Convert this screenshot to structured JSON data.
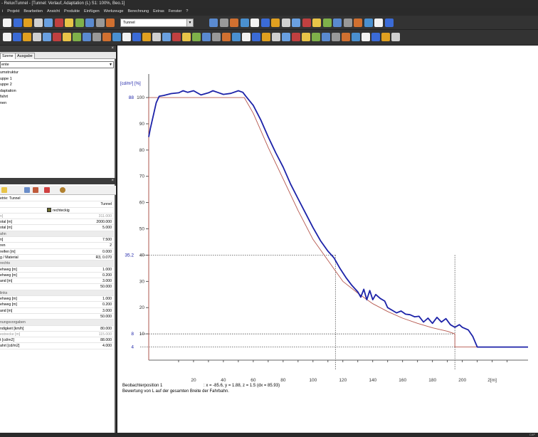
{
  "window": {
    "title": "- ReluxTunnel - [Tunnel: Verlauf, Adaptation (L) S1: 100%, Beo.1]"
  },
  "menu": {
    "items": [
      "i",
      "Projekt",
      "Bearbeiten",
      "Ansicht",
      "Produkte",
      "Einfügen",
      "Werkzeuge",
      "Berechnung",
      "Extras",
      "Fenster",
      "?"
    ]
  },
  "toolbar": {
    "tunnel_select": "Tunnel"
  },
  "left_panel": {
    "tabs": [
      "Szene",
      "Ausgabe"
    ],
    "tree_select": "ente",
    "tree_items": [
      "umstruktur",
      "uppe 1",
      "uppe 2",
      "daptation",
      "fahrt",
      "nen"
    ]
  },
  "properties": {
    "rows": [
      {
        "k": "etrie: Tunnel",
        "v": "",
        "type": "plain"
      },
      {
        "k": "",
        "v": "Tunnel",
        "type": "plain"
      },
      {
        "k": "",
        "v": "",
        "badge": "rechteckig",
        "type": "badge"
      },
      {
        "k": "n]",
        "v": "311.000",
        "type": "dim"
      },
      {
        "k": "otal [m]",
        "v": "2000.000",
        "type": "plain"
      },
      {
        "k": "otal [m]",
        "v": "5.000",
        "type": "plain"
      },
      {
        "k": "ahn",
        "v": "",
        "type": "section"
      },
      {
        "k": "n]",
        "v": "7.500",
        "type": "plain"
      },
      {
        "k": "ren",
        "v": "2",
        "type": "plain"
      },
      {
        "k": "reifen [m]",
        "v": "0.000",
        "type": "plain"
      },
      {
        "k": "g / Material",
        "v": "R3, 0.070",
        "type": "plain"
      },
      {
        "k": "rechts",
        "v": "",
        "type": "section"
      },
      {
        "k": "ehweg [m]",
        "v": "1.000",
        "type": "plain"
      },
      {
        "k": "ehweg [m]",
        "v": "0.200",
        "type": "plain"
      },
      {
        "k": "and [m]",
        "v": "3.000",
        "type": "plain"
      },
      {
        "k": "",
        "v": "50.000",
        "type": "plain"
      },
      {
        "k": "links",
        "v": "",
        "type": "section"
      },
      {
        "k": "ehweg [m]",
        "v": "1.000",
        "type": "plain"
      },
      {
        "k": "ehweg [m]",
        "v": "0.200",
        "type": "plain"
      },
      {
        "k": "and [m]",
        "v": "3.000",
        "type": "plain"
      },
      {
        "k": "",
        "v": "50.000",
        "type": "plain"
      },
      {
        "k": "nungsvorgaben",
        "v": "",
        "type": "section"
      },
      {
        "k": "ndigkeit [km/h]",
        "v": "80.000",
        "type": "plain"
      },
      {
        "k": "estrecke [m]",
        "v": "115.000",
        "type": "dim"
      },
      {
        "k": "t [cd/m2]",
        "v": "88.000",
        "type": "plain"
      },
      {
        "k": "ahrt [cd/m2]",
        "v": "4.000",
        "type": "plain"
      }
    ]
  },
  "chart_data": {
    "type": "line",
    "title": "",
    "ylabel": "[cd/m²] [%]",
    "xlabel": "[m]",
    "xlim": [
      -10,
      244
    ],
    "ylim": [
      0,
      103
    ],
    "x_ticks": [
      20,
      40,
      60,
      80,
      100,
      120,
      140,
      160,
      180,
      200,
      220
    ],
    "x_tick_labels": [
      "20",
      "40",
      "60",
      "80",
      "100",
      "120",
      "140",
      "160",
      "180",
      "200",
      "2[m]"
    ],
    "y_ticks": [
      10,
      20,
      30,
      40,
      50,
      60,
      70,
      80,
      90,
      100
    ],
    "y_tick_labels": [
      "10",
      "20",
      "30",
      "40",
      "50",
      "60",
      "70",
      "80",
      "90",
      "100"
    ],
    "cd_labels": [
      {
        "value": 88,
        "label": "88"
      },
      {
        "value": 35.2,
        "label": "35.2"
      },
      {
        "value": 8,
        "label": "8"
      },
      {
        "value": 4,
        "label": "4"
      }
    ],
    "reference_lines": [
      {
        "y": 40,
        "x_end": 115
      },
      {
        "y": 10,
        "x_end": 195
      },
      {
        "y": 5,
        "x_end": 195
      }
    ],
    "vertical_markers": [
      115,
      195
    ],
    "series": [
      {
        "color": "#b5574e",
        "x": [
          -10,
          -10,
          0,
          10,
          20,
          30,
          40,
          50,
          54,
          60,
          70,
          80,
          90,
          100,
          110,
          115,
          120,
          130,
          140,
          150,
          160,
          170,
          180,
          190,
          195,
          195,
          244
        ],
        "y": [
          0,
          100,
          100,
          100,
          100,
          100,
          100,
          100,
          100,
          94,
          81,
          69,
          57,
          46,
          38,
          34,
          30,
          25.5,
          21.5,
          18.5,
          16,
          14,
          12.3,
          11,
          10,
          5,
          5
        ]
      },
      {
        "color": "#1c22a8",
        "x": [
          -10,
          -9,
          -7,
          -5,
          -3,
          0,
          5,
          10,
          13,
          16,
          20,
          25,
          30,
          33,
          36,
          40,
          45,
          50,
          53,
          55,
          60,
          65,
          70,
          75,
          80,
          85,
          90,
          95,
          100,
          105,
          110,
          114,
          118,
          122,
          126,
          130,
          132,
          134,
          136,
          138,
          140,
          142,
          145,
          148,
          150,
          153,
          156,
          159,
          162,
          165,
          168,
          171,
          174,
          177,
          180,
          183,
          186,
          189,
          192,
          195,
          198,
          200,
          204,
          207,
          210,
          244
        ],
        "y": [
          85,
          88,
          93,
          98,
          100.5,
          100.8,
          101.5,
          101.8,
          102.6,
          102,
          102.6,
          101,
          101.8,
          102.6,
          102,
          101.2,
          101.6,
          102.6,
          102,
          100.5,
          97,
          91.5,
          85,
          79,
          73.5,
          67,
          61.5,
          56,
          50.5,
          45.5,
          41.5,
          39,
          35,
          31.5,
          28.5,
          26,
          24,
          27,
          23,
          26.5,
          23,
          25,
          23.5,
          22.5,
          20,
          19,
          18,
          18.7,
          17.5,
          17.3,
          16.5,
          16.7,
          14.5,
          16,
          14,
          16.3,
          14.5,
          15.8,
          13.5,
          12.5,
          13.5,
          12.5,
          11.5,
          9,
          5,
          5
        ]
      }
    ]
  },
  "status": {
    "line1_label": "Beobachterposition 1",
    "line1_value": ": x = -85.6, y = 1.88, z = 1.5 (dx = 85.93)",
    "line2": "Bewertung von L auf der gesamten Breite der Fahrbahn."
  },
  "statusbar": {
    "right_text": "CAP"
  }
}
